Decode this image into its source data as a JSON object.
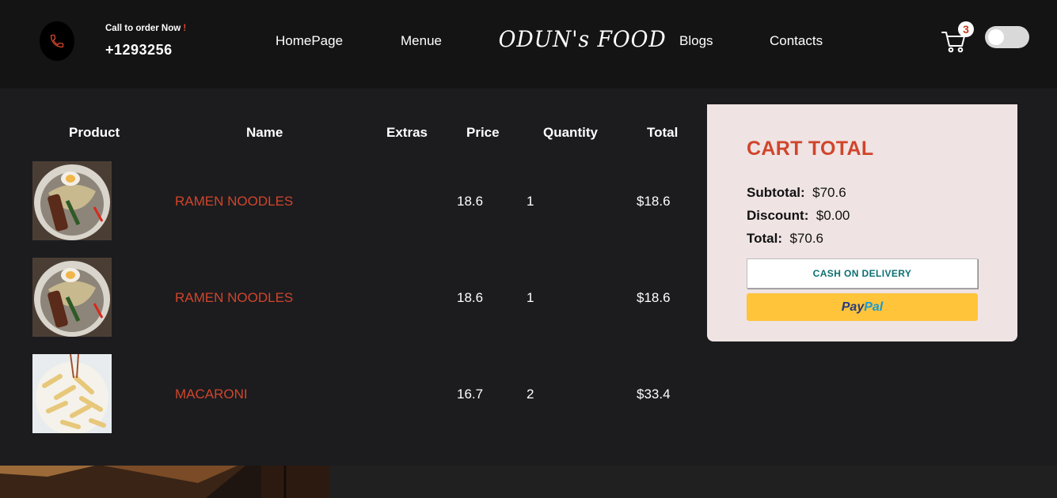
{
  "header": {
    "call_label": "Call to order Now",
    "call_bang": "!",
    "phone": "+1293256",
    "nav": [
      "HomePage",
      "Menue",
      "Blogs",
      "Contacts"
    ],
    "brand": "ODUN's FOOD",
    "cart_count": "3",
    "icons": {
      "phone": "phone-icon",
      "cart": "cart-icon",
      "toggle": "theme-toggle"
    }
  },
  "table": {
    "headers": [
      "Product",
      "Name",
      "Extras",
      "Price",
      "Quantity",
      "Total"
    ],
    "rows": [
      {
        "image": "ramen-noodles-photo",
        "name": "RAMEN NOODLES",
        "extras": "",
        "price": "18.6",
        "quantity": "1",
        "total": "$18.6"
      },
      {
        "image": "ramen-noodles-photo",
        "name": "RAMEN NOODLES",
        "extras": "",
        "price": "18.6",
        "quantity": "1",
        "total": "$18.6"
      },
      {
        "image": "macaroni-photo",
        "name": "MACARONI",
        "extras": "",
        "price": "16.7",
        "quantity": "2",
        "total": "$33.4"
      }
    ]
  },
  "cart_total": {
    "title": "CART TOTAL",
    "subtotal_label": "Subtotal:",
    "subtotal": "$70.6",
    "discount_label": "Discount:",
    "discount": "$0.00",
    "total_label": "Total:",
    "total": "$70.6",
    "cod_label": "CASH ON DELIVERY",
    "paypal_pay": "Pay",
    "paypal_pal": "Pal"
  },
  "colors": {
    "accent": "#d0452b",
    "background": "#1c1c1f",
    "header": "#141414",
    "panel": "#efe3e3",
    "paypal_yellow": "#ffc439"
  }
}
